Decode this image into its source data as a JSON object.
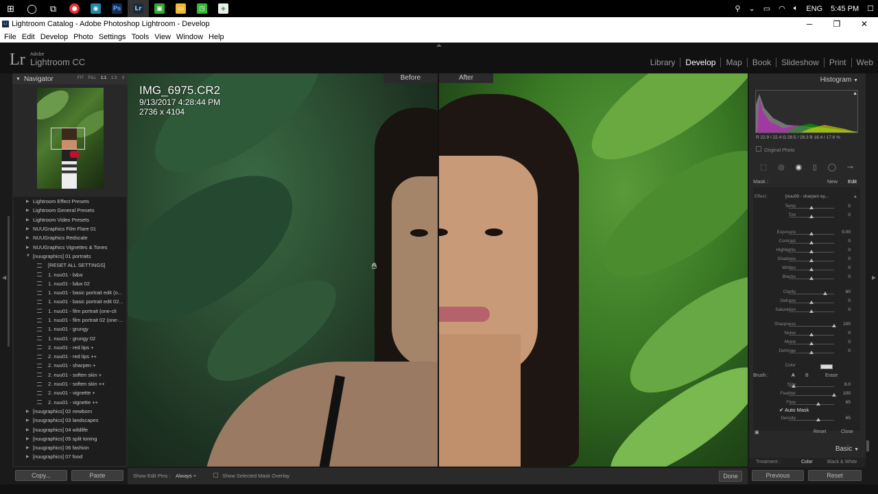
{
  "taskbar": {
    "lang": "ENG",
    "time": "5:45 PM"
  },
  "window": {
    "title": "Lightroom Catalog - Adobe Photoshop Lightroom - Develop",
    "min": "─",
    "max": "❐",
    "close": "✕"
  },
  "menu": [
    "File",
    "Edit",
    "Develop",
    "Photo",
    "Settings",
    "Tools",
    "View",
    "Window",
    "Help"
  ],
  "identity": {
    "adobe": "Adobe",
    "app": "Lightroom CC"
  },
  "modules": [
    "Library",
    "Develop",
    "Map",
    "Book",
    "Slideshow",
    "Print",
    "Web"
  ],
  "navigator": {
    "title": "Navigator",
    "zoom": [
      "FIT",
      "FILL",
      "1:1",
      "1:3"
    ]
  },
  "presets": [
    {
      "type": "folder",
      "label": "Lightroom Effect Presets"
    },
    {
      "type": "folder",
      "label": "Lightroom General Presets"
    },
    {
      "type": "folder",
      "label": "Lightroom Video Presets"
    },
    {
      "type": "folder",
      "label": "NUUGraphics Film Flare 01"
    },
    {
      "type": "folder",
      "label": "NUUGraphics Redscale"
    },
    {
      "type": "folder",
      "label": "NUUGraphics Vignettes & Tones"
    },
    {
      "type": "open",
      "label": "[nuugraphics] 01 portraits"
    },
    {
      "type": "item",
      "label": "[RESET ALL SETTINGS]"
    },
    {
      "type": "item",
      "label": "1. nuu01 - b&w"
    },
    {
      "type": "item",
      "label": "1. nuu01 - b&w 02"
    },
    {
      "type": "item",
      "label": "1. nuu01 - basic portrait edit (o..."
    },
    {
      "type": "item",
      "label": "1. nuu01 - basic portrait edit 02..."
    },
    {
      "type": "item",
      "label": "1. nuu01 - film portrait (one-cli"
    },
    {
      "type": "item",
      "label": "1. nuu01 - film portrait 02 (one-..."
    },
    {
      "type": "item",
      "label": "1. nuu01 - grungy"
    },
    {
      "type": "item",
      "label": "1. nuu01 - grungy 02"
    },
    {
      "type": "item",
      "label": "2. nuu01 - red lips +"
    },
    {
      "type": "item",
      "label": "2. nuu01 - red lips ++"
    },
    {
      "type": "item",
      "label": "2. nuu01 - sharpen +"
    },
    {
      "type": "item",
      "label": "2. nuu01 - soften skin +"
    },
    {
      "type": "item",
      "label": "2. nuu01 - soften skin ++"
    },
    {
      "type": "item",
      "label": "2. nuu01 - vignette +"
    },
    {
      "type": "item",
      "label": "2. nuu01 - vignette ++"
    },
    {
      "type": "folder",
      "label": "[nuugraphics] 02 newborn"
    },
    {
      "type": "folder",
      "label": "[nuugraphics] 03 landscapes"
    },
    {
      "type": "folder",
      "label": "[nuugraphics] 04 wildlife"
    },
    {
      "type": "folder",
      "label": "[nuugraphics] 05 split toning"
    },
    {
      "type": "folder",
      "label": "[nuugraphics] 06 fashion"
    },
    {
      "type": "folder",
      "label": "[nuugraphics] 07 food"
    }
  ],
  "photo": {
    "filename": "IMG_6975.CR2",
    "datetime": "9/13/2017 4:28:44 PM",
    "dimensions": "2736 x 4104",
    "before_label": "Before",
    "after_label": "After"
  },
  "histogram": {
    "title": "Histogram",
    "readout": "R 22.9 / 22.4  G 28.5 / 28.3  B 18.4 / 17.6 %",
    "original_photo": "Original Photo"
  },
  "mask": {
    "label": "Mask :",
    "new": "New",
    "edit": "Edit"
  },
  "effect": {
    "label": "Effect :",
    "preset": "[nuu09 - sharpen ey...",
    "sliders": [
      {
        "name": "Temp",
        "value": "0",
        "pos": 0.5
      },
      {
        "name": "Tint",
        "value": "0",
        "pos": 0.5
      },
      {
        "name": "Exposure",
        "value": "0.00",
        "pos": 0.5
      },
      {
        "name": "Contrast",
        "value": "0",
        "pos": 0.5
      },
      {
        "name": "Highlights",
        "value": "0",
        "pos": 0.5
      },
      {
        "name": "Shadows",
        "value": "0",
        "pos": 0.5
      },
      {
        "name": "Whites",
        "value": "0",
        "pos": 0.5
      },
      {
        "name": "Blacks",
        "value": "0",
        "pos": 0.5
      },
      {
        "name": "Clarity",
        "value": "60",
        "pos": 0.8
      },
      {
        "name": "Dehaze",
        "value": "0",
        "pos": 0.5
      },
      {
        "name": "Saturation",
        "value": "0",
        "pos": 0.5
      },
      {
        "name": "Sharpness",
        "value": "100",
        "pos": 1.0
      },
      {
        "name": "Noise",
        "value": "0",
        "pos": 0.5
      },
      {
        "name": "Moiré",
        "value": "0",
        "pos": 0.5
      },
      {
        "name": "Defringe",
        "value": "0",
        "pos": 0.5
      }
    ],
    "color_label": "Color"
  },
  "brush": {
    "label": "Brush :",
    "a": "A",
    "b": "B",
    "erase": "Erase",
    "sliders": [
      {
        "name": "Size",
        "value": "8.0",
        "pos": 0.1
      },
      {
        "name": "Feather",
        "value": "100",
        "pos": 1.0
      },
      {
        "name": "Flow",
        "value": "65",
        "pos": 0.65
      }
    ],
    "automask": "Auto Mask",
    "density": {
      "name": "Density",
      "value": "65",
      "pos": 0.65
    }
  },
  "panel_footer": {
    "reset": "Reset",
    "close": "Close"
  },
  "basic": {
    "title": "Basic",
    "treatment": "Treatment :",
    "color": "Color",
    "bw": "Black & White"
  },
  "toolbar": {
    "copy": "Copy...",
    "paste": "Paste",
    "show_pins": "Show Edit Pins :",
    "pins_value": "Always ÷",
    "overlay": "Show Selected Mask Overlay",
    "done": "Done",
    "previous": "Previous",
    "reset": "Reset"
  }
}
